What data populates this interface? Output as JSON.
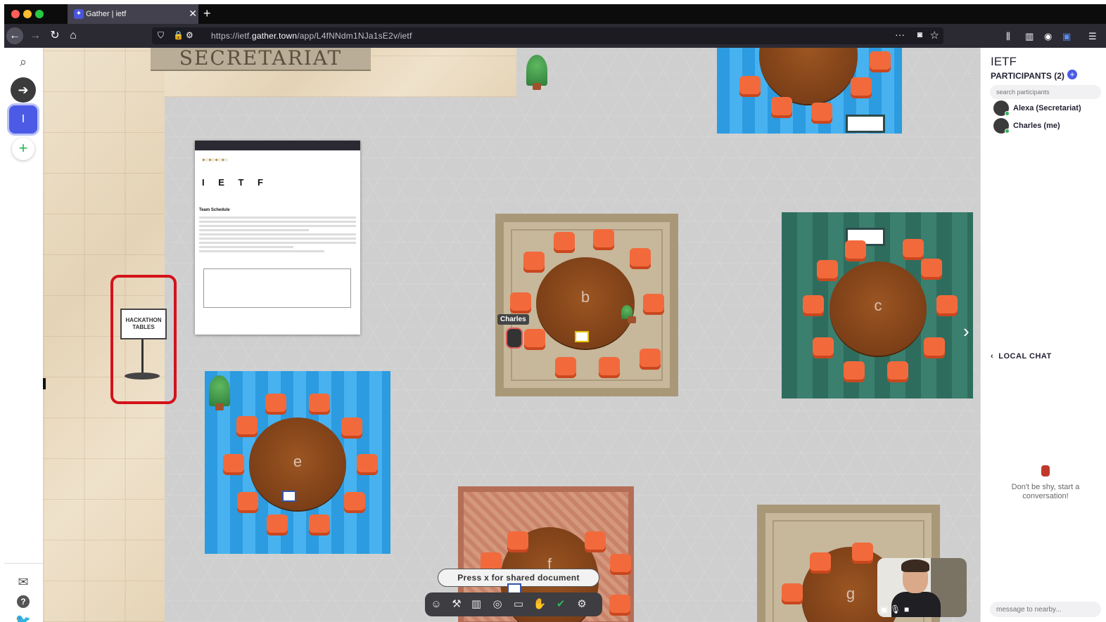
{
  "browser": {
    "tab_title": "Gather | ietf",
    "tab_favicon": "gather-logo-icon",
    "url_host_prefix": "https://ietf.",
    "url_host": "gather.town",
    "url_path": "/app/L4fNNdm1NJa1sE2v/ietf"
  },
  "map": {
    "wall_sign": "SECRETARIAT",
    "hackathon_sign": "HACKATHON TABLES",
    "tables": [
      "b",
      "c",
      "e",
      "f",
      "g"
    ],
    "player_name": "Charles",
    "hint": "Press x for shared document",
    "shared_doc": {
      "brand": "I E T F",
      "heading": "Team Schedule"
    }
  },
  "panel": {
    "title": "IETF",
    "participants_label": "PARTICIPANTS (2)",
    "search_placeholder": "search participants",
    "participants": [
      {
        "name": "Alexa (Secretariat)",
        "status_color": "#2fb45a"
      },
      {
        "name": "Charles (me)",
        "status_color": "#2fb45a"
      }
    ],
    "chat_header": "LOCAL CHAT",
    "empty_chat": "Don't be shy, start a conversation!",
    "message_placeholder": "message to nearby..."
  },
  "colors": {
    "accent": "#4c5be6",
    "online": "#2fb45a",
    "highlight_red": "#d4121b"
  }
}
